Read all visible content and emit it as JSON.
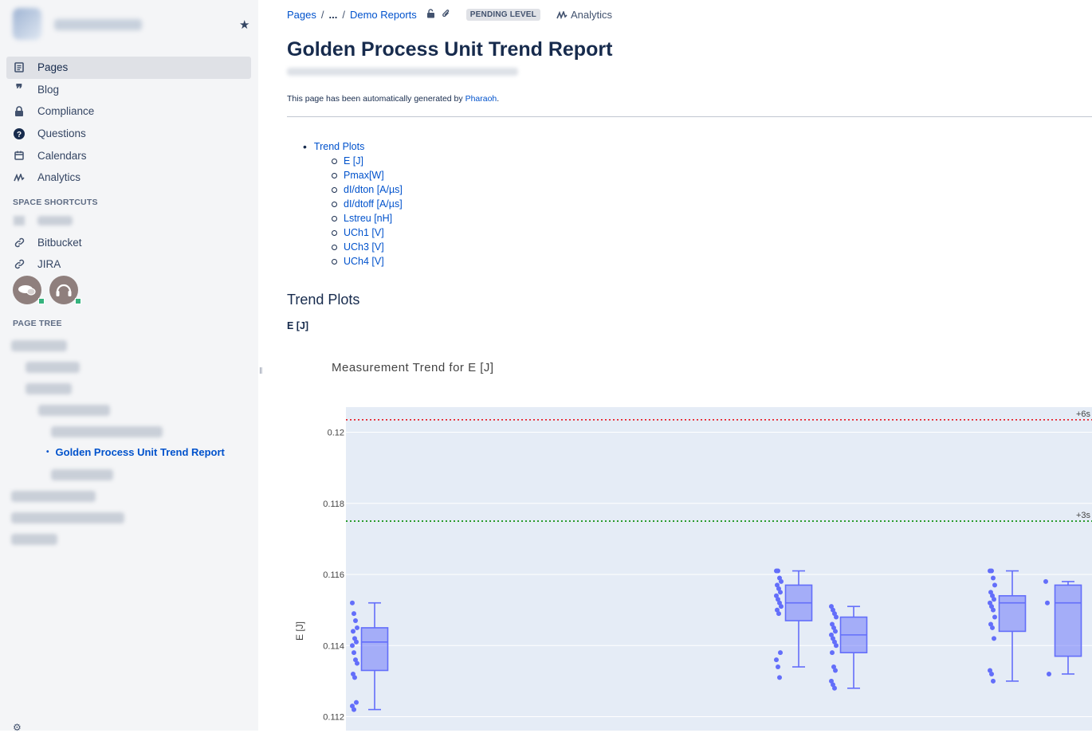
{
  "sidebar": {
    "nav": [
      {
        "label": "Pages",
        "icon": "pages-icon",
        "active": true
      },
      {
        "label": "Blog",
        "icon": "quote-icon",
        "active": false
      },
      {
        "label": "Compliance",
        "icon": "lock-icon",
        "active": false
      },
      {
        "label": "Questions",
        "icon": "question-icon",
        "active": false
      },
      {
        "label": "Calendars",
        "icon": "calendar-icon",
        "active": false
      },
      {
        "label": "Analytics",
        "icon": "analytics-icon",
        "active": false
      }
    ],
    "space_shortcuts_heading": "SPACE SHORTCUTS",
    "shortcuts": [
      {
        "label": "Bitbucket",
        "icon": "link-icon"
      },
      {
        "label": "JIRA",
        "icon": "link-icon"
      }
    ],
    "page_tree_heading": "PAGE TREE",
    "current_page": "Golden Process Unit Trend Report"
  },
  "breadcrumb": {
    "items": [
      "Pages",
      "...",
      "Demo Reports"
    ],
    "status": "PENDING LEVEL",
    "analytics_label": "Analytics"
  },
  "page": {
    "title": "Golden Process Unit Trend Report",
    "notice_prefix": "This page has been automatically generated by ",
    "notice_link": "Pharaoh",
    "notice_suffix": "."
  },
  "toc": {
    "top": "Trend Plots",
    "items": [
      "E [J]",
      "Pmax[W]",
      "dI/dton [A/µs]",
      "dI/dtoff [A/µs]",
      "Lstreu [nH]",
      "UCh1 [V]",
      "UCh3 [V]",
      "UCh4 [V]"
    ]
  },
  "section_heading": "Trend Plots",
  "subsection_heading": "E [J]",
  "colors": {
    "accent": "#0052cc",
    "box": "#636efa",
    "plot_bg": "#e5ecf6",
    "limit_high": "#e8000b",
    "limit_mid": "#008a00"
  },
  "chart_data": {
    "type": "box",
    "title": "Measurement Trend for E [J]",
    "ylabel": "E [J]",
    "xlabel": "",
    "ylim": [
      0.1118,
      0.1221
    ],
    "yticks": [
      0.112,
      0.114,
      0.116,
      0.118,
      0.12
    ],
    "grid": true,
    "reference_lines": [
      {
        "label": "+6s",
        "value": 0.12035,
        "color": "#e8000b",
        "style": "dotted"
      },
      {
        "label": "+3s",
        "value": 0.1175,
        "color": "#008a00",
        "style": "dotted"
      }
    ],
    "series": [
      {
        "slot": 0,
        "min": 0.1122,
        "q1": 0.1133,
        "median": 0.1141,
        "q3": 0.1145,
        "max": 0.1152,
        "points": [
          0.1152,
          0.1149,
          0.1147,
          0.1145,
          0.1144,
          0.1142,
          0.1141,
          0.114,
          0.1138,
          0.1136,
          0.1135,
          0.1132,
          0.1131,
          0.1124,
          0.1123,
          0.1122
        ]
      },
      {
        "slot": 1,
        "min": 0.1134,
        "q1": 0.1147,
        "median": 0.1152,
        "q3": 0.1157,
        "max": 0.1161,
        "points": [
          0.1161,
          0.1161,
          0.1159,
          0.1158,
          0.1157,
          0.1156,
          0.1155,
          0.1154,
          0.1153,
          0.1152,
          0.1151,
          0.115,
          0.1149,
          0.1138,
          0.1136,
          0.1134,
          0.1131
        ]
      },
      {
        "slot": 2,
        "min": 0.1128,
        "q1": 0.1138,
        "median": 0.1143,
        "q3": 0.1148,
        "max": 0.1151,
        "points": [
          0.1151,
          0.115,
          0.1149,
          0.1148,
          0.1146,
          0.1145,
          0.1144,
          0.1143,
          0.1142,
          0.1141,
          0.114,
          0.1138,
          0.1134,
          0.1133,
          0.113,
          0.1129,
          0.1128
        ]
      },
      {
        "slot": 3,
        "min": 0.113,
        "q1": 0.1144,
        "median": 0.1152,
        "q3": 0.1154,
        "max": 0.1161,
        "points": [
          0.1161,
          0.1161,
          0.1159,
          0.1157,
          0.1155,
          0.1154,
          0.1153,
          0.1152,
          0.1151,
          0.115,
          0.1148,
          0.1146,
          0.1145,
          0.1142,
          0.1133,
          0.1132,
          0.113
        ]
      },
      {
        "slot": 4,
        "min": 0.1132,
        "q1": 0.1137,
        "median": 0.1152,
        "q3": 0.1157,
        "max": 0.1158,
        "points": [
          0.1158,
          0.1152,
          0.1132
        ]
      }
    ]
  }
}
